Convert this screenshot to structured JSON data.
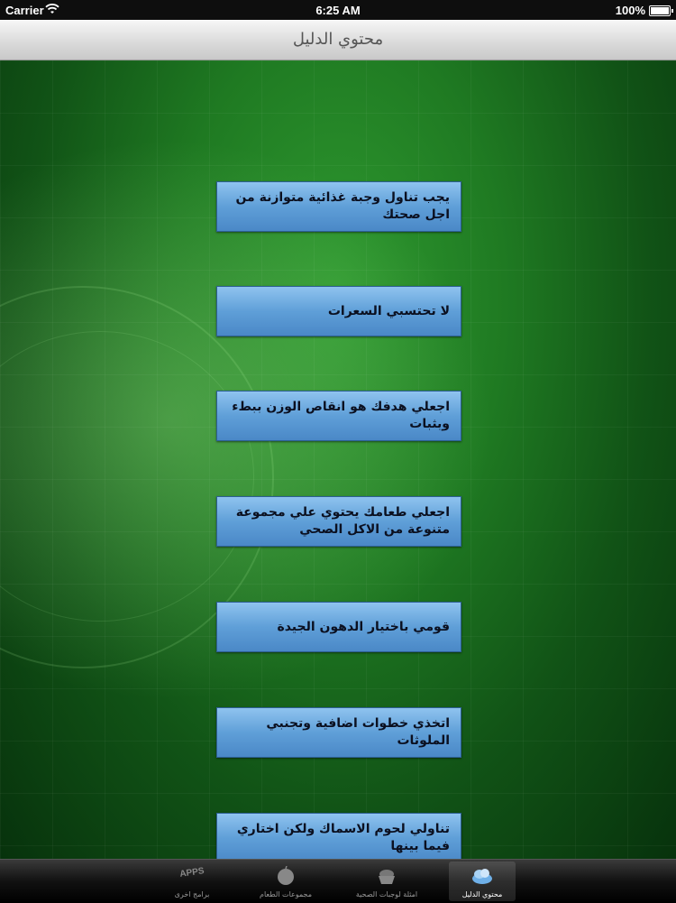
{
  "status_bar": {
    "carrier": "Carrier",
    "time": "6:25 AM",
    "battery": "100%"
  },
  "nav": {
    "title": "محتوي الدليل"
  },
  "guide_items": [
    "يجب تناول وجبة غذائية متوازنة من اجل صحتك",
    "لا تحتسبي السعرات",
    "اجعلي هدفك هو انقاص الوزن ببطء وبثبات",
    "اجعلي طعامك يحتوي علي مجموعة متنوعة من الاكل الصحي",
    "قومي باختيار الدهون الجيدة",
    "اتخذي خطوات اضافية وتجنبي الملوثات",
    "تناولي لحوم الاسماك  ولكن اختاري فيما بينها"
  ],
  "tab_bar": {
    "tabs": [
      {
        "label": "محتوي الدليل",
        "icon": "cloud-icon",
        "selected": true
      },
      {
        "label": "امثلة لوجبات الصحية",
        "icon": "basket-icon",
        "selected": false
      },
      {
        "label": "مجموعات الطعام",
        "icon": "apple-icon",
        "selected": false
      },
      {
        "label": "برامج اخرى",
        "icon": "apps-icon",
        "icon_text": "APPS",
        "selected": false
      }
    ]
  }
}
